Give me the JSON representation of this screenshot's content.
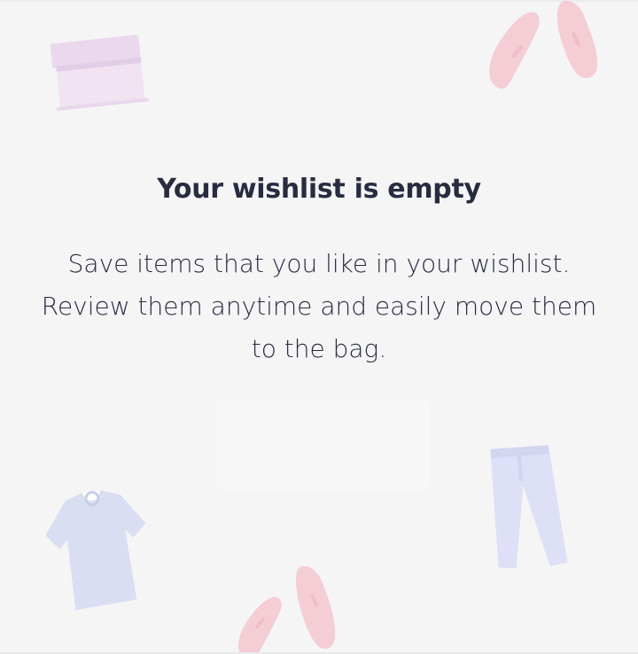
{
  "empty_state": {
    "title": "Your wishlist is empty",
    "message": "Save items that you like in your wishlist. Review them anytime and easily move them to the bag."
  },
  "colors": {
    "background": "#f5f5f6",
    "text": "#282c3f",
    "pink_illustration": "#f2c5cf",
    "purple_illustration": "#e4d7ec",
    "blue_illustration": "#d9dcf2"
  },
  "icons": [
    "box-icon",
    "shoes-icon",
    "shirt-icon",
    "trousers-icon",
    "sneakers-icon"
  ]
}
